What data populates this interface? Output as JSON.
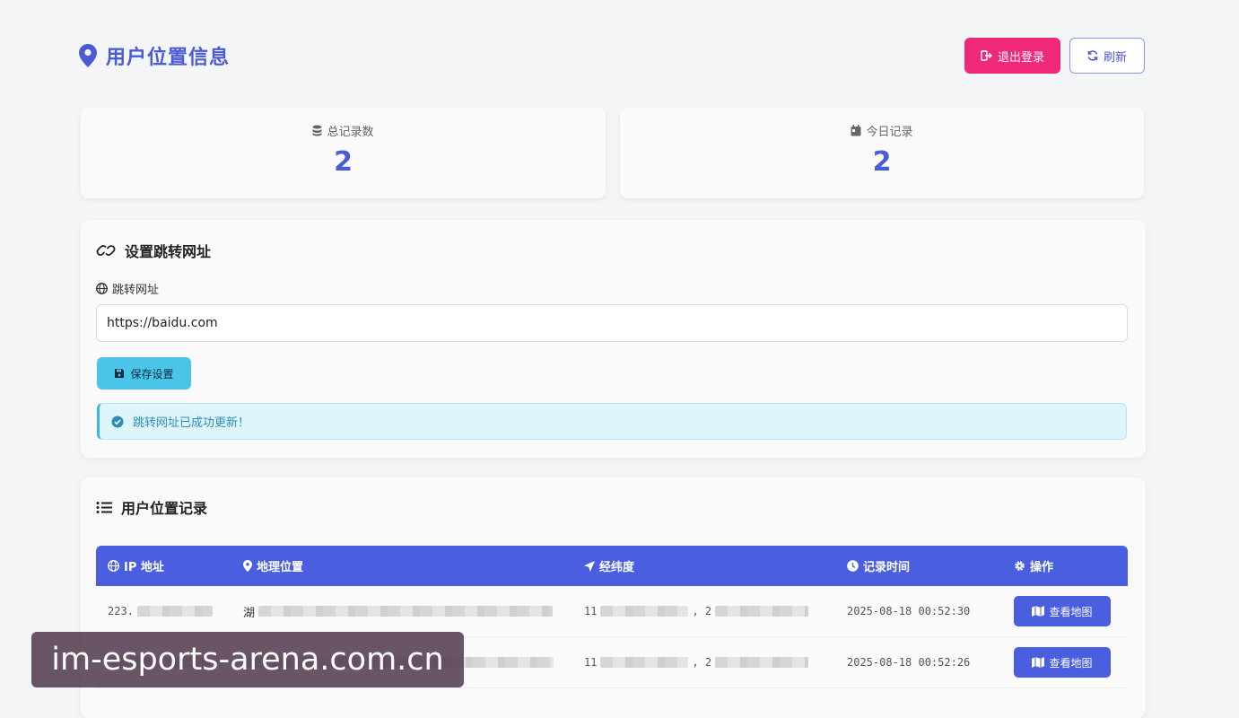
{
  "header": {
    "title": "用户位置信息",
    "logout_label": "退出登录",
    "refresh_label": "刷新"
  },
  "stats": {
    "total_label": "总记录数",
    "total_value": "2",
    "today_label": "今日记录",
    "today_value": "2"
  },
  "redirect": {
    "title": "设置跳转网址",
    "field_label": "跳转网址",
    "url_value": "https://baidu.com",
    "save_label": "保存设置",
    "alert": "跳转网址已成功更新！"
  },
  "records": {
    "title": "用户位置记录",
    "columns": {
      "ip": "IP 地址",
      "geo": "地理位置",
      "latlng": "经纬度",
      "time": "记录时间",
      "op": "操作"
    },
    "rows": [
      {
        "ip": "223.",
        "geo": "湖",
        "lat": "11",
        "lng_sep": ", 2",
        "time": "2025-08-18 00:52:30",
        "action": "查看地图"
      },
      {
        "ip": "",
        "geo": "",
        "lat": "11",
        "lng_sep": ", 2",
        "time": "2025-08-18 00:52:26",
        "action": "查看地图"
      }
    ]
  },
  "watermark": "im-esports-arena.com.cn",
  "colors": {
    "accent": "#4a5bd6",
    "table_header": "#4a5fe0",
    "logout": "#f0287a",
    "save": "#4ac4e8",
    "alert_bg": "#dff5fd"
  }
}
